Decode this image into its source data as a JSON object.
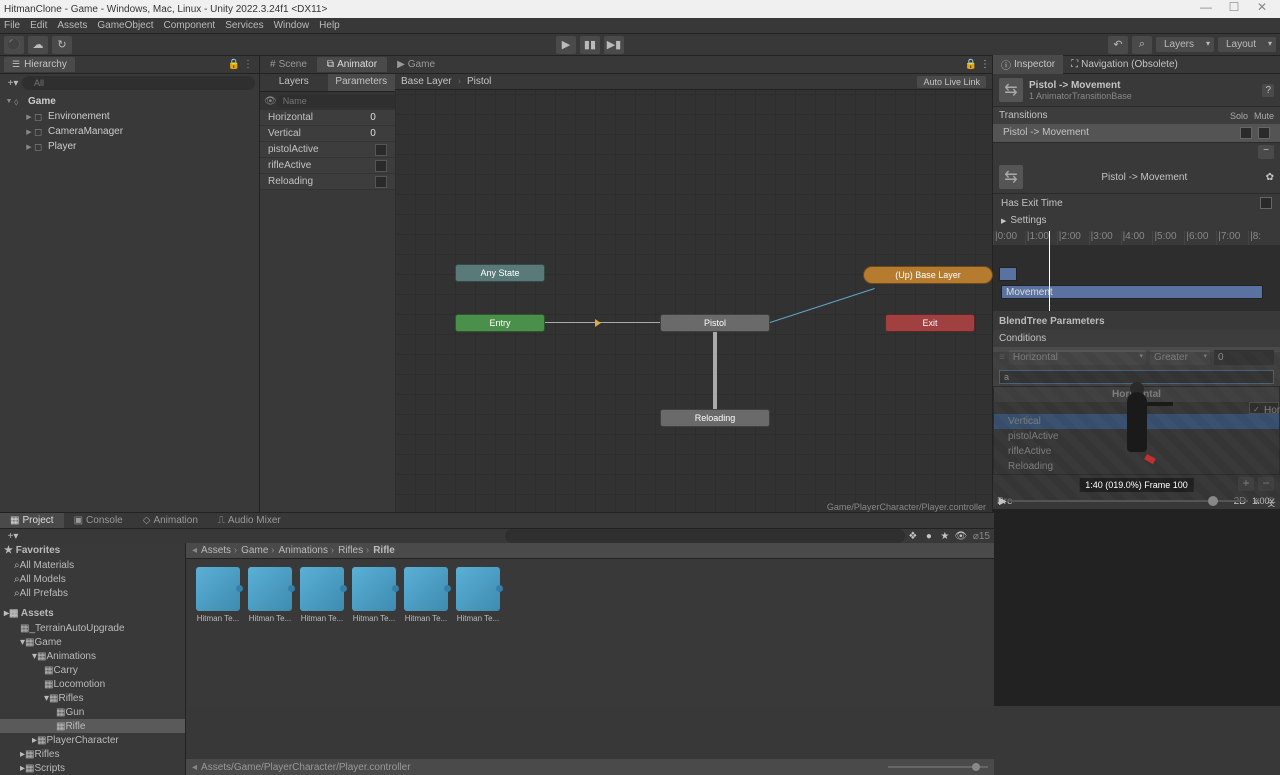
{
  "window": {
    "title": "HitmanClone - Game - Windows, Mac, Linux - Unity 2022.3.24f1 <DX11>"
  },
  "menu": {
    "file": "File",
    "edit": "Edit",
    "assets": "Assets",
    "gameObject": "GameObject",
    "component": "Component",
    "services": "Services",
    "window": "Window",
    "help": "Help"
  },
  "toolbar": {
    "layers": "Layers",
    "layout": "Layout"
  },
  "hierarchy": {
    "title": "Hierarchy",
    "search": "All",
    "scene": "Game",
    "items": [
      "Environement",
      "CameraManager",
      "Player"
    ]
  },
  "centerTabs": {
    "scene": "Scene",
    "animator": "Animator",
    "game": "Game"
  },
  "animator": {
    "layersTab": "Layers",
    "paramsTab": "Parameters",
    "nameLabel": "Name",
    "params": [
      {
        "name": "Horizontal",
        "val": "0"
      },
      {
        "name": "Vertical",
        "val": "0"
      },
      {
        "name": "pistolActive",
        "chk": true
      },
      {
        "name": "rifleActive",
        "chk": true
      },
      {
        "name": "Reloading",
        "chk": true
      }
    ],
    "breadcrumb": {
      "base": "Base Layer",
      "sub": "Pistol",
      "autoLive": "Auto Live Link"
    },
    "nodes": {
      "any": "Any State",
      "entry": "Entry",
      "exit": "Exit",
      "up": "(Up) Base Layer",
      "pistol": "Pistol",
      "reload": "Reloading"
    },
    "footer": "Game/PlayerCharacter/Player.controller"
  },
  "inspector": {
    "tab1": "Inspector",
    "tab2": "Navigation (Obsolete)",
    "title": "Pistol -> Movement",
    "sub": "1 AnimatorTransitionBase",
    "transitions": "Transitions",
    "solo": "Solo",
    "mute": "Mute",
    "translabel": "Pistol -> Movement",
    "diagram": "Pistol -> Movement",
    "hasExit": "Has Exit Time",
    "settings": "Settings",
    "ticks": [
      "|0:00",
      "|1:00",
      "|2:00",
      "|3:00",
      "|4:00",
      "|5:00",
      "|6:00",
      "|7:00",
      "|8:"
    ],
    "clip2": "Movement",
    "blendParams": "BlendTree Parameters",
    "conditions": "Conditions",
    "cond": {
      "param": "Horizontal",
      "op": "Greater",
      "val": "0"
    },
    "searchVal": "a",
    "dropdown": {
      "head": "Horizontal",
      "items": [
        "Horizontal",
        "Vertical",
        "pistolActive",
        "rifleActive",
        "Reloading"
      ]
    },
    "preview": {
      "label": "Pre",
      "2d": "2D",
      "info": "1:40 (019.0%) Frame 100",
      "speed": "1.00x"
    }
  },
  "bottomTabs": {
    "project": "Project",
    "console": "Console",
    "animation": "Animation",
    "audioMixer": "Audio Mixer"
  },
  "project": {
    "favorites": "Favorites",
    "favItems": [
      "All Materials",
      "All Models",
      "All Prefabs"
    ],
    "assets": "Assets",
    "tree": [
      "_TerrainAutoUpgrade",
      "Game",
      "Animations",
      "Carry",
      "Locomotion",
      "Rifles",
      "Gun",
      "Rifle",
      "PlayerCharacter",
      "Rifles",
      "Scripts"
    ],
    "path": [
      "Assets",
      "Game",
      "Animations",
      "Rifles",
      "Rifle"
    ],
    "items": [
      "Hitman Te...",
      "Hitman Te...",
      "Hitman Te...",
      "Hitman Te...",
      "Hitman Te...",
      "Hitman Te..."
    ],
    "footer": "Assets/Game/PlayerCharacter/Player.controller",
    "count": "⌀15"
  }
}
